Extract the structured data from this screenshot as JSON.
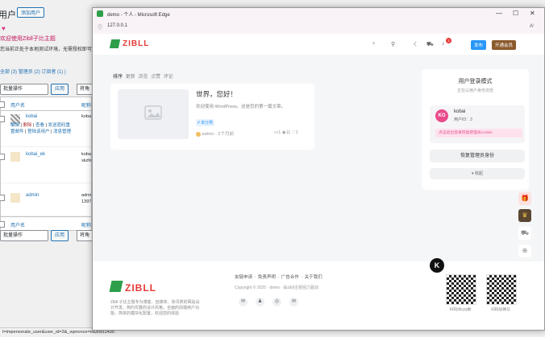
{
  "wp": {
    "title": "用户",
    "add_new": "添加用户",
    "heart": "♥",
    "welcome": "欢迎使用Zibll子比主题",
    "notice": "您当前正处于本地测试环境，无需授权即可",
    "filters": [
      "全部 (3)",
      "管理员 (2)",
      "订阅者 (1)",
      "|"
    ],
    "bulk_action": "批量操作",
    "apply": "应用",
    "change_role": "将角色",
    "col_username": "用户名",
    "col_name": "昵称",
    "rows": [
      {
        "username": "kobai",
        "name": "koba",
        "actions": [
          "编辑",
          "删除",
          "查看",
          "发送密码重置邮件",
          "登陆该用户",
          "消息管理"
        ]
      },
      {
        "username": "kobai_ek",
        "name": "koba",
        "name2": "skzhi"
      },
      {
        "username": "admin",
        "name": "admi",
        "name2": "1397"
      }
    ],
    "status_url": "t=impersonate_user&user_id=3&_wpnonce=ea30911435"
  },
  "edge": {
    "tab_title": "demo - 个人 - Microsoft Edge",
    "url": "127.0.0.1",
    "controls": [
      "—",
      "☐",
      "✕"
    ]
  },
  "site": {
    "logo": "ZIBLL",
    "publish": "发布",
    "vip": "开通会员",
    "badge": "2",
    "tabs": [
      "排序",
      "更新",
      "浏览",
      "点赞",
      "评论"
    ],
    "post": {
      "title": "世界，您好！",
      "excerpt": "欢迎使用 WordPress。这是您的第一篇文章。",
      "tag": "# 未分类",
      "author": "admin",
      "time": "2个月前",
      "comments": "1",
      "views": "11",
      "likes": "1"
    },
    "panel": {
      "title": "用户登录模式",
      "subtitle": "正在以用户身份浏览",
      "avatar": "KO",
      "username": "kobai",
      "userid": "用户ID：3",
      "warning": "点击退出登录恢复管理员cookie",
      "restore": "恢复管理员身份",
      "collapse": "▾ 收起"
    },
    "footer": {
      "links": "友链申请 · 免责声明 · 广告合作 · 关于我们",
      "copyright": "Copyright © 2025 · demo · 由zibll主题强力驱动",
      "desc": "Zibll 子比主题专为博客、自媒体、资讯类的网站设计开发，简约优雅的设计风格，全面的前端用户功能，简单的模块化配置，欢迎您的体验",
      "qr1_label": "扫码加QQ群",
      "qr2_label": "扫码加微信"
    },
    "k": "K"
  },
  "colors": {
    "accent": "#2997f7",
    "brand": "#e53935",
    "pink": "#e94b8b",
    "wp_link": "#2271b1"
  }
}
